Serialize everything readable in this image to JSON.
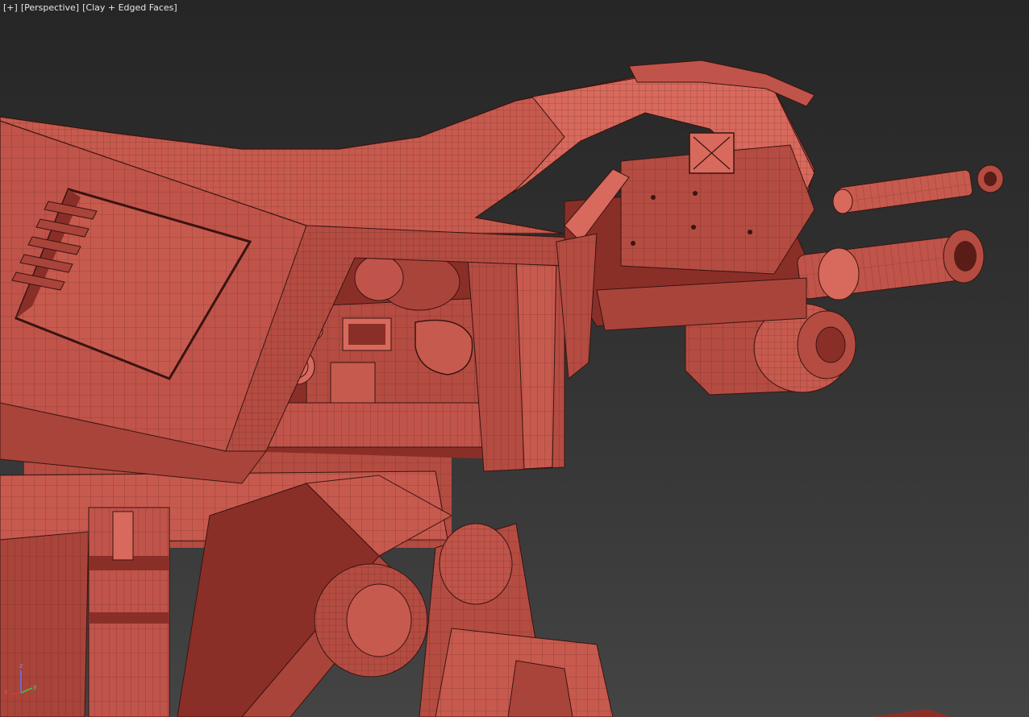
{
  "viewport": {
    "menu_label": "[+]",
    "view_label": "[Perspective]",
    "shading_label": "[Clay + Edged Faces]"
  },
  "gizmo": {
    "x_label": "x",
    "y_label": "y",
    "z_label": "z",
    "colors": {
      "x": "#d23c3c",
      "y": "#3cc83c",
      "z": "#5a78ff"
    }
  },
  "model": {
    "clay_color": "#c4564b",
    "shadow_color": "#8a2f28",
    "highlight_color": "#d8695d",
    "wire_color": "#3a1410"
  }
}
